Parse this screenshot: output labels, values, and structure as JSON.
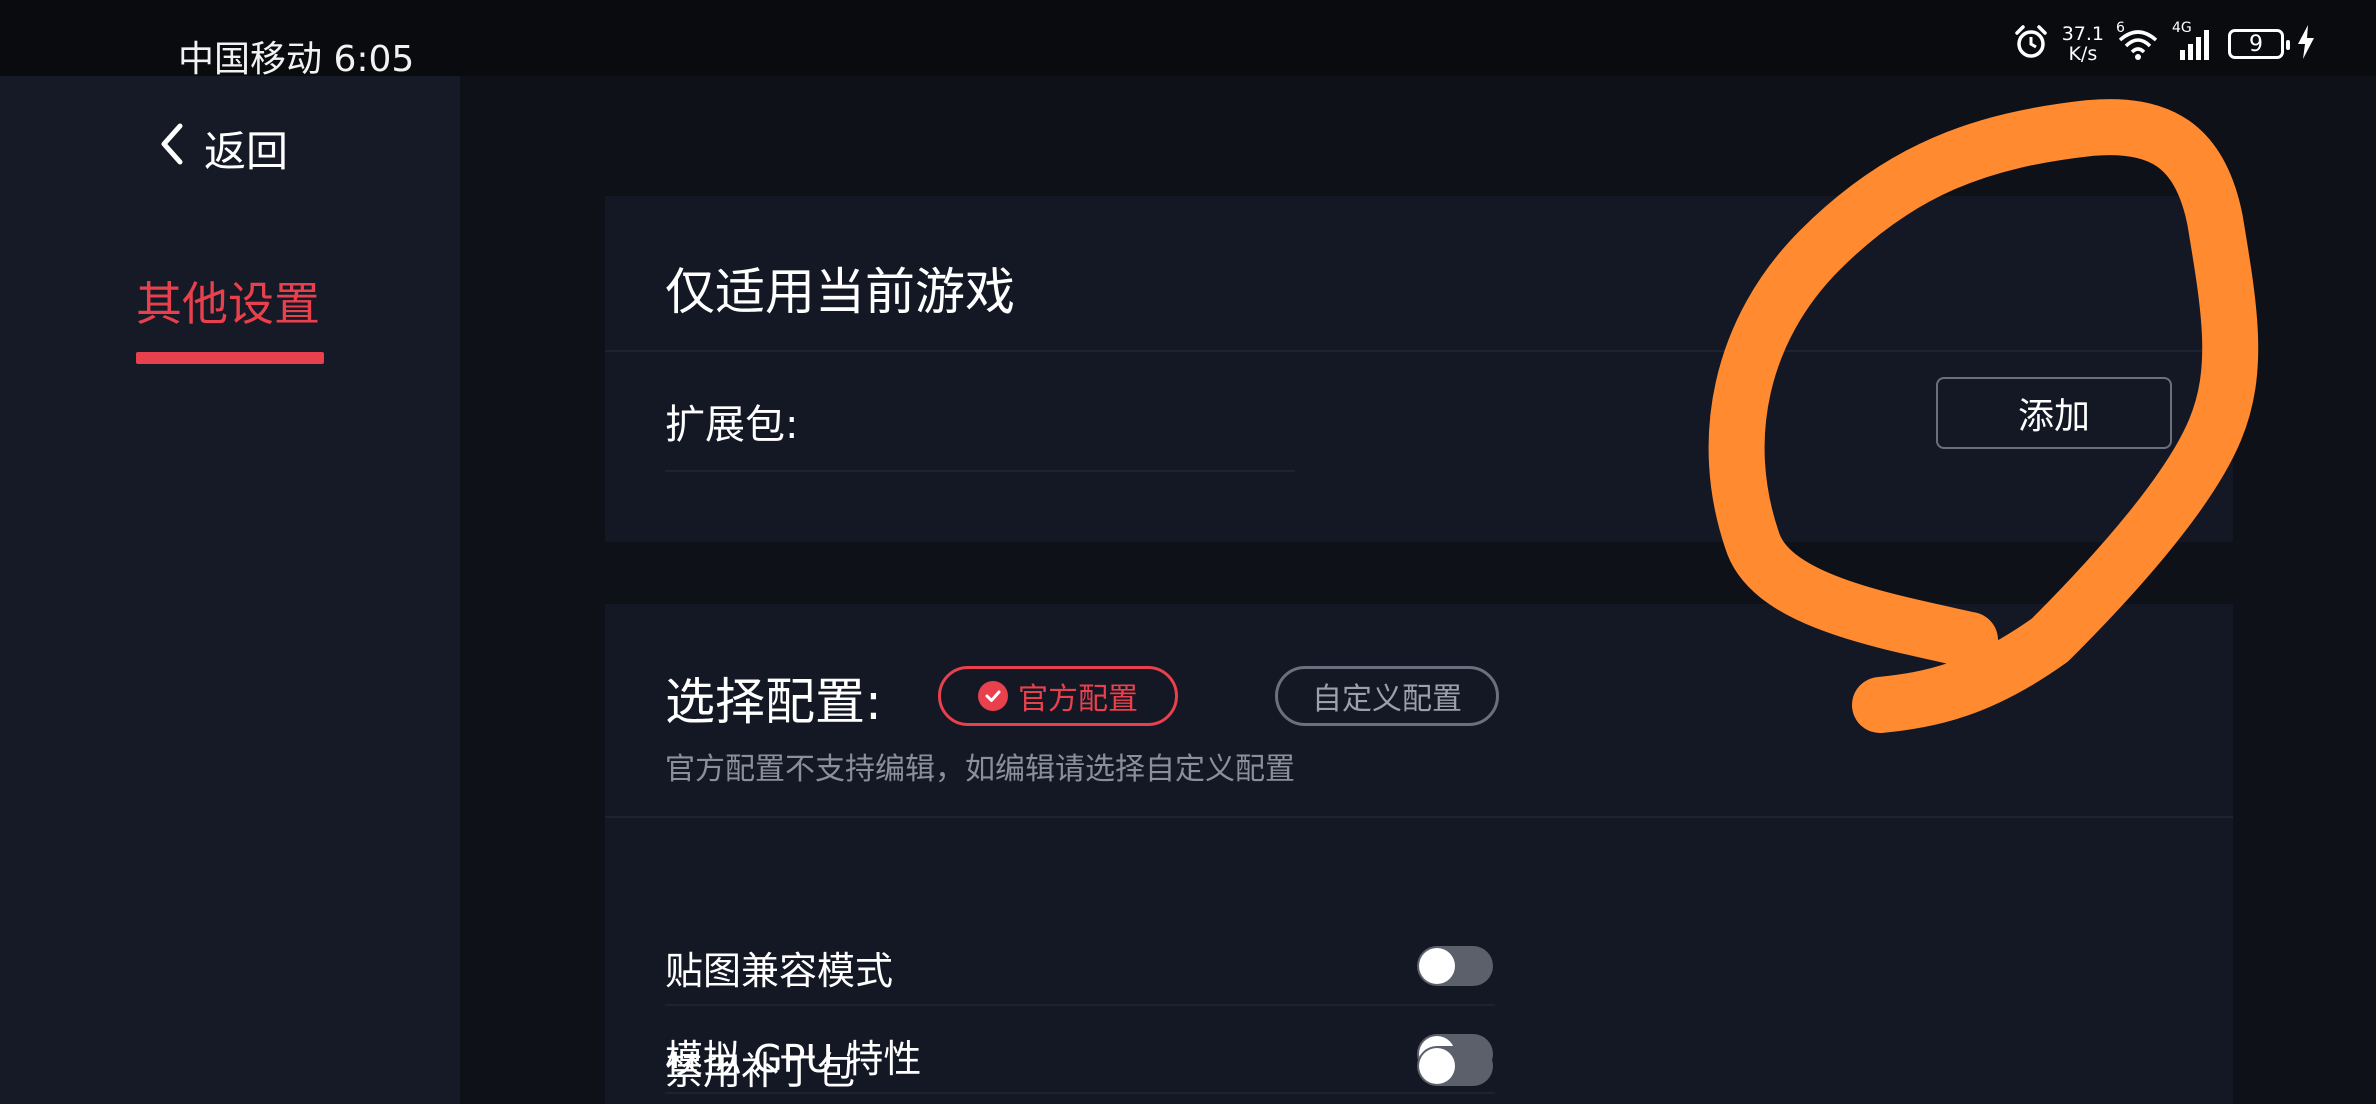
{
  "status_bar": {
    "carrier_time": "中国移动 6:05",
    "net_speed_value": "37.1",
    "net_speed_unit": "K/s",
    "wifi_label": "6",
    "signal_label": "4G",
    "battery_level": "9"
  },
  "sidebar": {
    "back_label": "返回",
    "active_tab": "其他设置"
  },
  "game_section": {
    "title": "仅适用当前游戏",
    "expansion_label": "扩展包:",
    "add_button": "添加"
  },
  "config_section": {
    "title": "选择配置:",
    "official_option": "官方配置",
    "custom_option": "自定义配置",
    "hint": "官方配置不支持编辑，如编辑请选择自定义配置",
    "toggles": [
      {
        "label": "贴图兼容模式",
        "on": false
      },
      {
        "label": "模拟 GPU 特性",
        "on": false
      },
      {
        "label": "禁用补丁包",
        "on": false
      }
    ]
  },
  "colors": {
    "accent": "#e8404c",
    "annotation": "#ff8a30",
    "background": "#0f1118"
  }
}
